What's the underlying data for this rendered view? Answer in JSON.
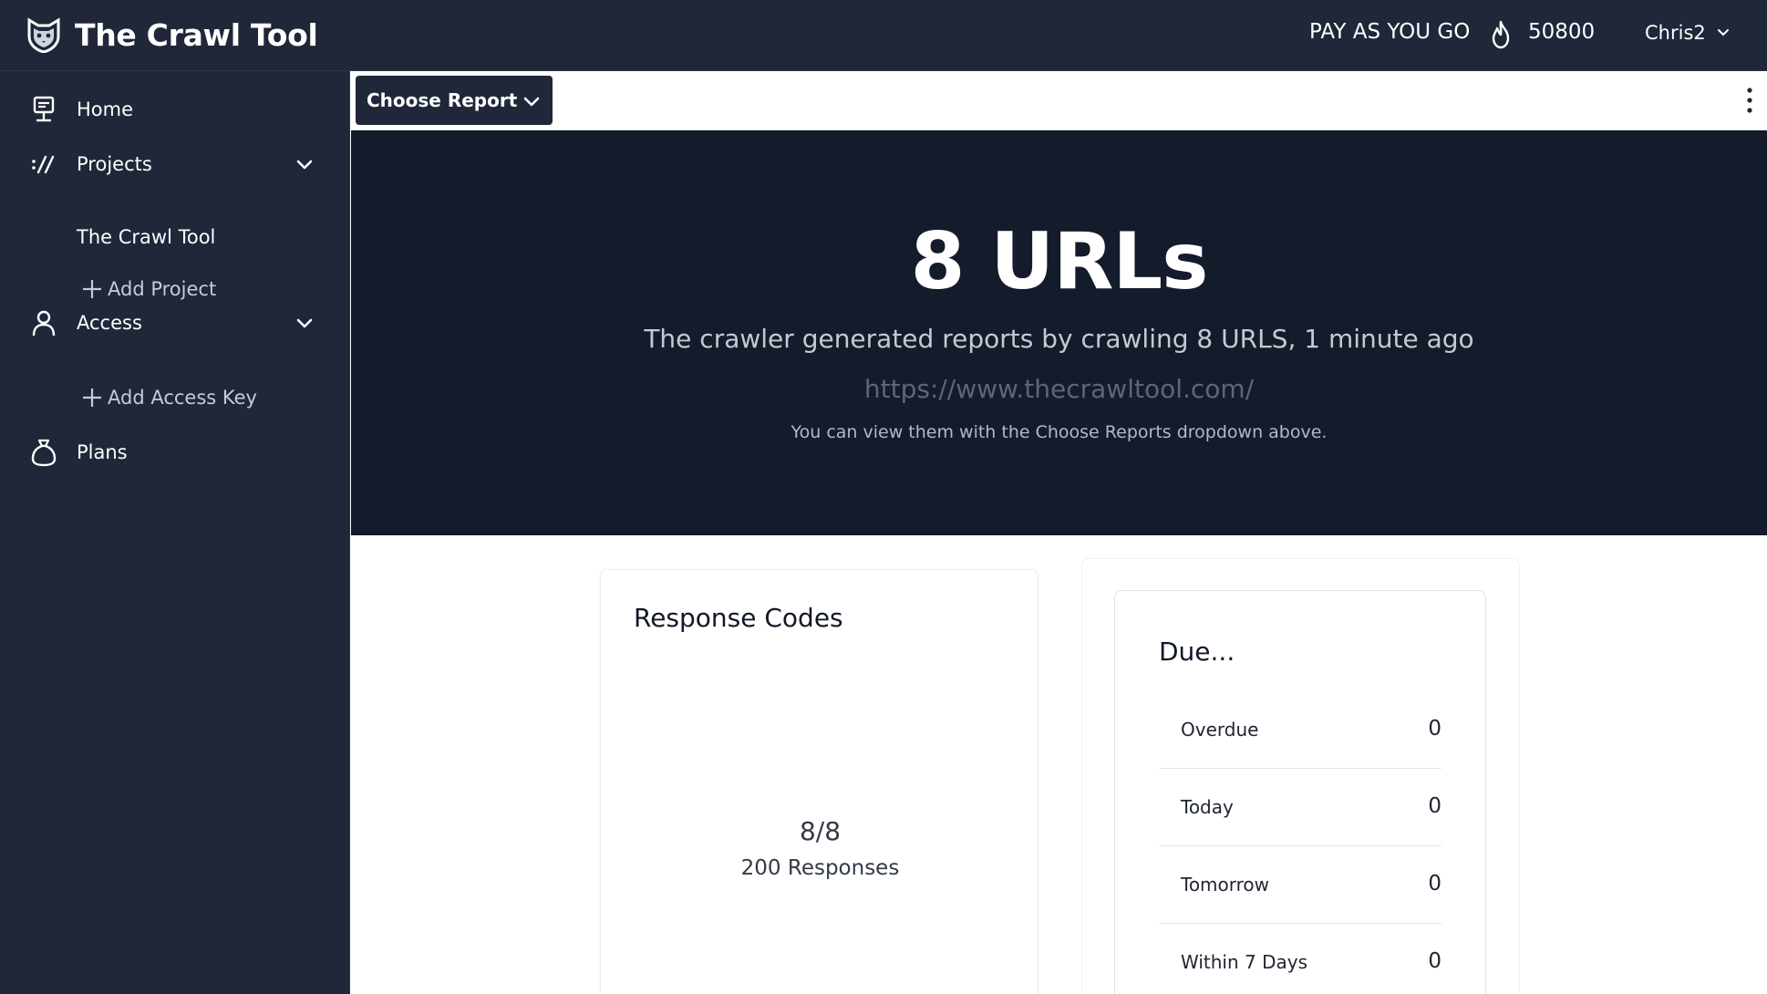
{
  "header": {
    "app_title": "The Crawl Tool",
    "plan": "PAY AS YOU GO",
    "credits": "50800",
    "user_name": "Chris2",
    "logo_icon": "cat-shield-logo",
    "credits_icon": "flame-icon"
  },
  "sidebar": {
    "home": {
      "label": "Home",
      "icon": "monitor-icon"
    },
    "projects": {
      "label": "Projects",
      "icon": "slashes-icon",
      "items": [
        "The Crawl Tool"
      ],
      "add_label": "Add Project"
    },
    "access": {
      "label": "Access",
      "icon": "user-icon",
      "add_label": "Add Access Key"
    },
    "plans": {
      "label": "Plans",
      "icon": "bag-icon"
    }
  },
  "toolbar": {
    "choose_report_label": "Choose Report"
  },
  "hero": {
    "title": "8 URLs",
    "subtitle": "The crawler generated reports by crawling 8 URLS, 1 minute ago",
    "url": "https://www.thecrawltool.com/",
    "note": "You can view them with the Choose Reports dropdown above."
  },
  "response_codes": {
    "title": "Response Codes",
    "ratio": "8/8",
    "count_label": "200 Responses"
  },
  "due": {
    "title": "Due...",
    "rows": [
      {
        "label": "Overdue",
        "value": "0"
      },
      {
        "label": "Today",
        "value": "0"
      },
      {
        "label": "Tomorrow",
        "value": "0"
      },
      {
        "label": "Within 7 Days",
        "value": "0"
      }
    ]
  },
  "colors": {
    "sidebar_bg": "#1f2738",
    "hero_bg": "#141b2b",
    "text_light": "#ffffff"
  }
}
